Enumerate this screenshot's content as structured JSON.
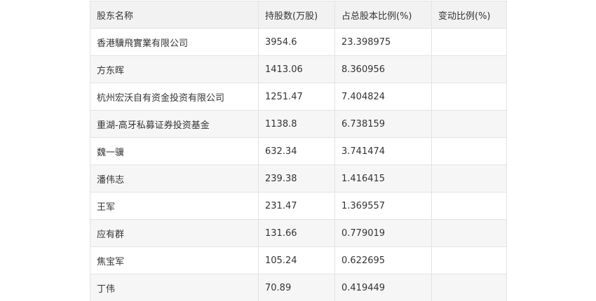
{
  "table": {
    "headers": [
      "股东名称",
      "持股数(万股)",
      "占总股本比例(%)",
      "变动比例(%)"
    ],
    "rows": [
      [
        "香港驥飛實業有限公司",
        "3954.6",
        "23.398975",
        ""
      ],
      [
        "方东晖",
        "1413.06",
        "8.360956",
        ""
      ],
      [
        "杭州宏沃自有资金投资有限公司",
        "1251.47",
        "7.404824",
        ""
      ],
      [
        "重湖-高牙私募证券投资基金",
        "1138.8",
        "6.738159",
        ""
      ],
      [
        "魏一骥",
        "632.34",
        "3.741474",
        ""
      ],
      [
        "潘伟志",
        "239.38",
        "1.416415",
        ""
      ],
      [
        "王军",
        "231.47",
        "1.369557",
        ""
      ],
      [
        "应有群",
        "131.66",
        "0.779019",
        ""
      ],
      [
        "焦宝军",
        "105.24",
        "0.622695",
        ""
      ],
      [
        "丁伟",
        "70.89",
        "0.419449",
        ""
      ]
    ]
  }
}
